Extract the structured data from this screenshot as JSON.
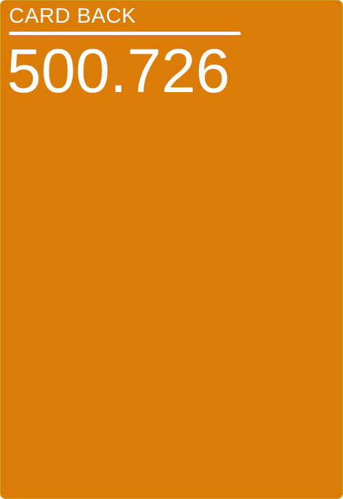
{
  "card": {
    "title": "CARD BACK",
    "code": "500.726"
  },
  "colors": {
    "card_background": "#db7c06",
    "card_border": "#c9a227",
    "text": "#ffffff",
    "rule": "#ffffff"
  }
}
